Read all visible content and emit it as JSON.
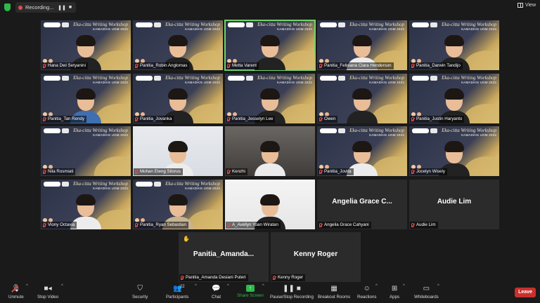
{
  "topbar": {
    "recording_label": "Recording...",
    "view_label": "View"
  },
  "workshop": {
    "title": "Eka-citta Writing Workshop",
    "subtitle": "KAMADHIS UGM 2023"
  },
  "participants": [
    {
      "name": "Hana Dwi Setyanini",
      "bg": "zoom",
      "body": "dark"
    },
    {
      "name": "Panitia_Robin Anglomas",
      "bg": "zoom",
      "body": "dark"
    },
    {
      "name": "Metta Varent",
      "bg": "zoom",
      "body": "dark",
      "active": true
    },
    {
      "name": "Panitia_Felisiana Clara Henderson",
      "bg": "zoom",
      "body": "white"
    },
    {
      "name": "Panitia_Darwin Tandijo",
      "bg": "zoom",
      "body": "dark"
    },
    {
      "name": "Panitia_Tan Rendy",
      "bg": "zoom",
      "body": "blue"
    },
    {
      "name": "Panitia_Jovanka",
      "bg": "zoom",
      "body": "dark"
    },
    {
      "name": "Panitia_Jesselyn Lee",
      "bg": "zoom",
      "body": "dark"
    },
    {
      "name": "Owen",
      "bg": "zoom",
      "body": "dark"
    },
    {
      "name": "Panitia_Justin Haryanto",
      "bg": "zoom",
      "body": "dark"
    },
    {
      "name": "Nila Rosmiati",
      "bg": "zoom",
      "body": "none"
    },
    {
      "name": "Mohan Eteng Sitorus",
      "bg": "room",
      "body": "white"
    },
    {
      "name": "Kenzhi",
      "bg": "room2",
      "body": "white"
    },
    {
      "name": "Panitia_Jovita",
      "bg": "zoom",
      "body": "white"
    },
    {
      "name": "Jocelyn Wisely",
      "bg": "zoom",
      "body": "dark"
    },
    {
      "name": "Viony Octavia",
      "bg": "zoom",
      "body": "white"
    },
    {
      "name": "Panitia_Ryan Sebastian",
      "bg": "zoom",
      "body": "beige"
    },
    {
      "name": "A_Avellyn Yoan Wiratan",
      "bg": "white",
      "body": "dark"
    },
    {
      "name": "Angelia Grace Cahyani",
      "bg": "plain",
      "big": "Angelia Grace C..."
    },
    {
      "name": "Audie Lim",
      "bg": "plain",
      "big": "Audie Lim"
    },
    {
      "name": "Panitia_Amanda Desiani Puteri",
      "bg": "plain",
      "big": "Panitia_Amanda..."
    },
    {
      "name": "Kenny Roger",
      "bg": "plain",
      "big": "Kenny Roger"
    }
  ],
  "toolbar": {
    "unmute": "Unmute",
    "stop_video": "Stop Video",
    "security": "Security",
    "participants": "Participants",
    "participants_count": "22",
    "chat": "Chat",
    "share_screen": "Share Screen",
    "pause_recording": "Pause/Stop Recording",
    "breakout_rooms": "Breakout Rooms",
    "reactions": "Reactions",
    "apps": "Apps",
    "whiteboards": "Whiteboards",
    "leave": "Leave"
  },
  "colors": {
    "accent_green": "#2eb84b",
    "leave_red": "#c9302c",
    "mute_red": "#e34b4b",
    "active_outline": "#6fd36b"
  }
}
